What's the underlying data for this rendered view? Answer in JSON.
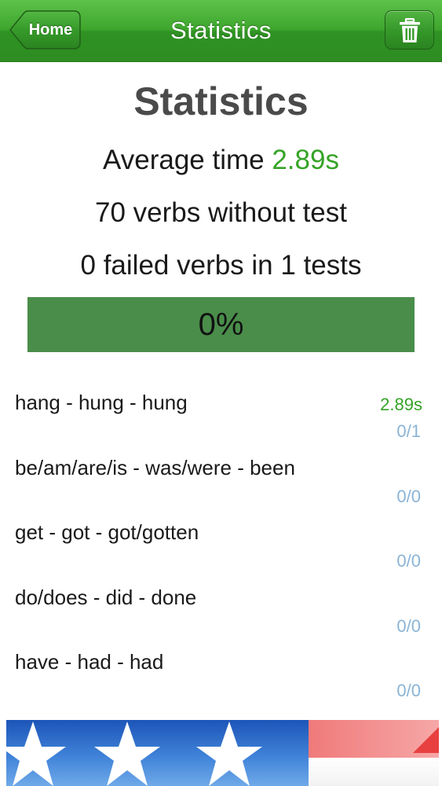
{
  "navbar": {
    "title": "Statistics",
    "home_label": "Home",
    "home_icon": "back-arrow-button",
    "trash_icon": "trash-icon",
    "color": "#3ea52d"
  },
  "main": {
    "title": "Statistics",
    "average_prefix": "Average time ",
    "average_value": "2.89s",
    "untested": "70 verbs without test",
    "failed": "0 failed verbs in 1 tests",
    "progress": {
      "label": "0%",
      "value": 0
    }
  },
  "verbs": [
    {
      "forms": "hang - hung - hung",
      "time": "2.89s",
      "score": "0/1"
    },
    {
      "forms": "be/am/are/is - was/were - been",
      "time": "",
      "score": "0/0"
    },
    {
      "forms": "get - got - got/gotten",
      "time": "",
      "score": "0/0"
    },
    {
      "forms": "do/does - did - done",
      "time": "",
      "score": "0/0"
    },
    {
      "forms": "have - had - had",
      "time": "",
      "score": "0/0"
    }
  ],
  "colors": {
    "accent_green": "#35a327",
    "score_blue": "#8ab4d6",
    "progress_bar": "#4a8d4a"
  },
  "banner": {
    "icon": "us-flag-icon"
  }
}
